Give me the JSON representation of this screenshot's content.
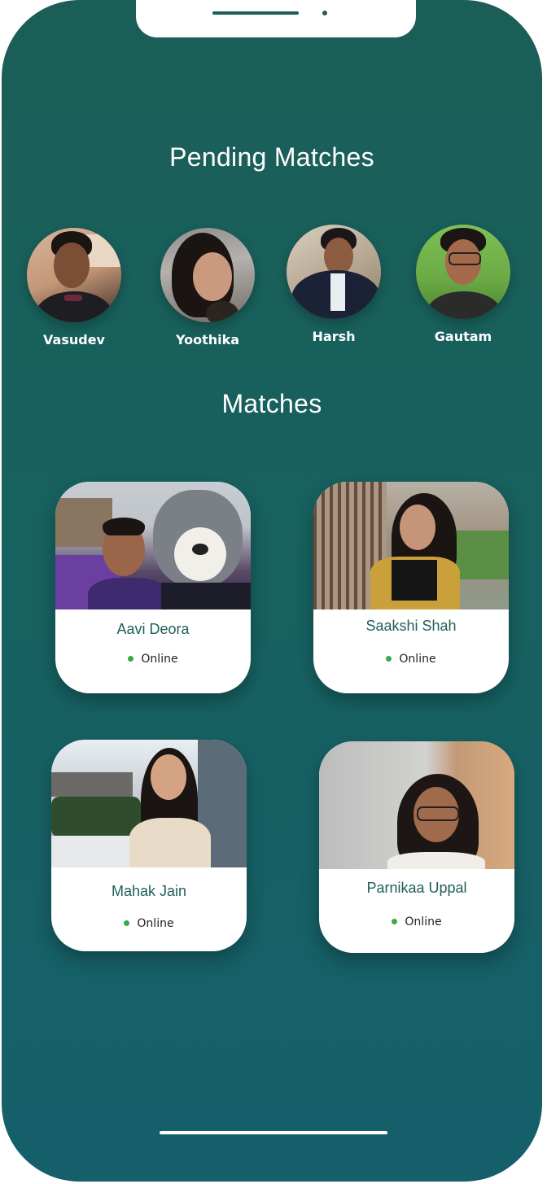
{
  "pending": {
    "title": "Pending Matches",
    "users": [
      {
        "name": "Vasudev",
        "icon": "avatar-photo"
      },
      {
        "name": "Yoothika",
        "icon": "avatar-photo"
      },
      {
        "name": "Harsh",
        "icon": "avatar-photo"
      },
      {
        "name": "Gautam",
        "icon": "avatar-photo"
      }
    ]
  },
  "matches": {
    "title": "Matches",
    "cards": [
      {
        "name": "Aavi Deora",
        "status": "Online"
      },
      {
        "name": "Saakshi Shah",
        "status": "Online"
      },
      {
        "name": "Mahak Jain",
        "status": "Online"
      },
      {
        "name": "Parnikaa Uppal",
        "status": "Online"
      }
    ]
  },
  "colors": {
    "background_top": "#1b5e57",
    "background_bottom": "#155f6b",
    "online": "#3ba94a",
    "card_name": "#1f5f5a"
  }
}
